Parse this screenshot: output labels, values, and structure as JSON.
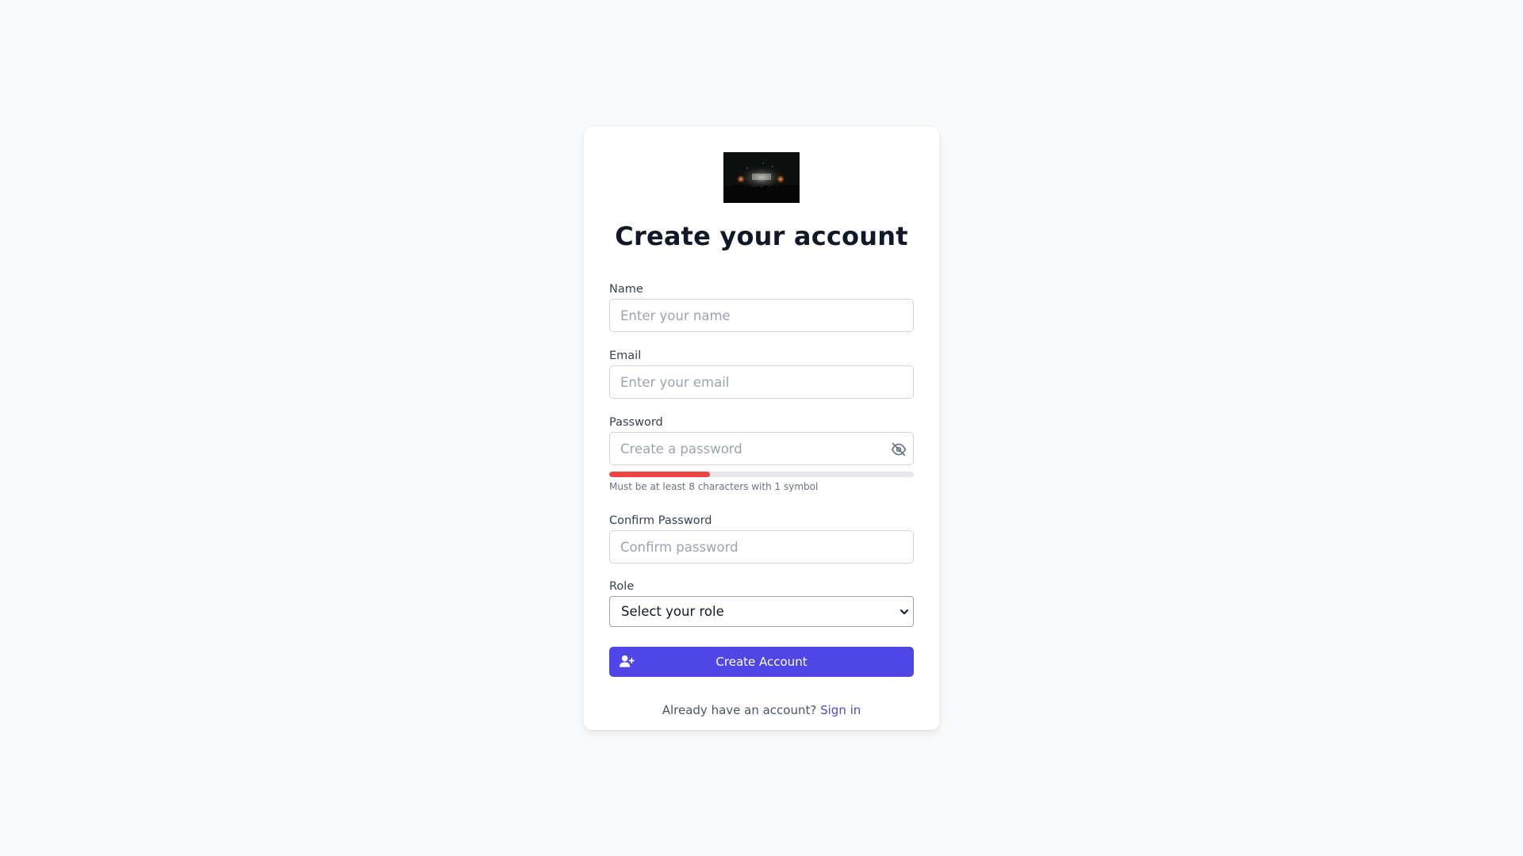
{
  "page": {
    "title": "Create your account"
  },
  "logo": {
    "icon": "concert-crowd-image"
  },
  "form": {
    "name": {
      "label": "Name",
      "value": "",
      "placeholder": "Enter your name"
    },
    "email": {
      "label": "Email",
      "value": "",
      "placeholder": "Enter your email"
    },
    "password": {
      "label": "Password",
      "value": "",
      "placeholder": "Create a password",
      "toggle_icon": "eye-slash-icon",
      "strength_fraction": 0.33,
      "strength_color": "#ef4444",
      "hint": "Must be at least 8 characters with 1 symbol"
    },
    "confirm_password": {
      "label": "Confirm Password",
      "value": "",
      "placeholder": "Confirm password"
    },
    "role": {
      "label": "Role",
      "selected": "Select your role"
    },
    "submit": {
      "label": "Create Account",
      "icon": "user-plus-icon"
    }
  },
  "footer": {
    "prompt": "Already have an account?",
    "link_label": "Sign in"
  },
  "colors": {
    "accent": "#4f46e5",
    "background": "#f9fafb",
    "card": "#ffffff"
  }
}
